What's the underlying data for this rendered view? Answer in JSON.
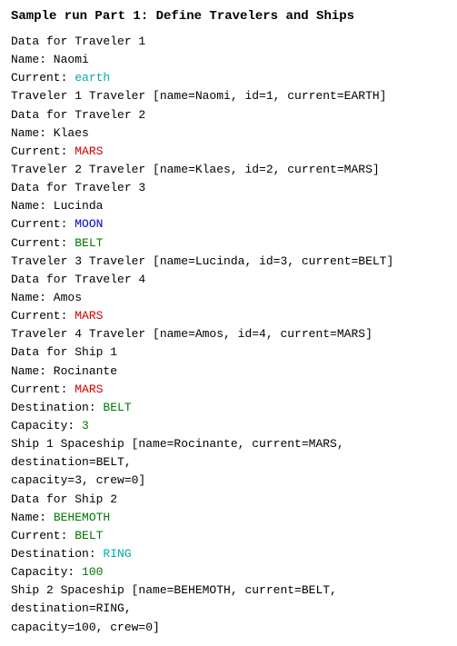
{
  "title": "Sample run Part 1: Define Travelers and Ships",
  "lines": [
    {
      "id": "l1",
      "parts": [
        {
          "text": "Data for Traveler 1",
          "color": "black"
        }
      ]
    },
    {
      "id": "l2",
      "parts": [
        {
          "text": "Name: Naomi",
          "color": "black"
        }
      ]
    },
    {
      "id": "l3",
      "parts": [
        {
          "text": "Current: ",
          "color": "black"
        },
        {
          "text": "earth",
          "color": "cyan"
        }
      ]
    },
    {
      "id": "l4",
      "parts": [
        {
          "text": "Traveler 1 Traveler [name=Naomi, id=1, current=EARTH]",
          "color": "black"
        }
      ]
    },
    {
      "id": "l5",
      "parts": [
        {
          "text": "Data for Traveler 2",
          "color": "black"
        }
      ]
    },
    {
      "id": "l6",
      "parts": [
        {
          "text": "Name: Klaes",
          "color": "black"
        }
      ]
    },
    {
      "id": "l7",
      "parts": [
        {
          "text": "Current: ",
          "color": "black"
        },
        {
          "text": "MARS",
          "color": "red"
        }
      ]
    },
    {
      "id": "l8",
      "parts": [
        {
          "text": "Traveler 2 Traveler [name=Klaes, id=2, current=MARS]",
          "color": "black"
        }
      ]
    },
    {
      "id": "l9",
      "parts": [
        {
          "text": "Data for Traveler 3",
          "color": "black"
        }
      ]
    },
    {
      "id": "l10",
      "parts": [
        {
          "text": "Name: Lucinda",
          "color": "black"
        }
      ]
    },
    {
      "id": "l11",
      "parts": [
        {
          "text": "Current: ",
          "color": "black"
        },
        {
          "text": "MOON",
          "color": "blue"
        }
      ]
    },
    {
      "id": "l12",
      "parts": [
        {
          "text": "Current: ",
          "color": "black"
        },
        {
          "text": "BELT",
          "color": "green"
        }
      ]
    },
    {
      "id": "l13",
      "parts": [
        {
          "text": "Traveler 3 Traveler [name=Lucinda, id=3, current=BELT]",
          "color": "black"
        }
      ]
    },
    {
      "id": "l14",
      "parts": [
        {
          "text": "Data for Traveler 4",
          "color": "black"
        }
      ]
    },
    {
      "id": "l15",
      "parts": [
        {
          "text": "Name: Amos",
          "color": "black"
        }
      ]
    },
    {
      "id": "l16",
      "parts": [
        {
          "text": "Current: ",
          "color": "black"
        },
        {
          "text": "MARS",
          "color": "red"
        }
      ]
    },
    {
      "id": "l17",
      "parts": [
        {
          "text": "Traveler 4 Traveler [name=Amos, id=4, current=MARS]",
          "color": "black"
        }
      ]
    },
    {
      "id": "l18",
      "parts": [
        {
          "text": "Data for Ship 1",
          "color": "black"
        }
      ]
    },
    {
      "id": "l19",
      "parts": [
        {
          "text": "Name: Rocinante",
          "color": "black"
        }
      ]
    },
    {
      "id": "l20",
      "parts": [
        {
          "text": "Current: ",
          "color": "black"
        },
        {
          "text": "MARS",
          "color": "red"
        }
      ]
    },
    {
      "id": "l21",
      "parts": [
        {
          "text": "Destination: ",
          "color": "black"
        },
        {
          "text": "BELT",
          "color": "green"
        }
      ]
    },
    {
      "id": "l22",
      "parts": [
        {
          "text": "Capacity: ",
          "color": "black"
        },
        {
          "text": "3",
          "color": "green"
        }
      ]
    },
    {
      "id": "l23",
      "parts": [
        {
          "text": "Ship 1 Spaceship [name=Rocinante, current=MARS, destination=BELT,",
          "color": "black"
        }
      ]
    },
    {
      "id": "l24",
      "parts": [
        {
          "text": "capacity=3, crew=0]",
          "color": "black"
        }
      ]
    },
    {
      "id": "l25",
      "parts": [
        {
          "text": "Data for Ship 2",
          "color": "black"
        }
      ]
    },
    {
      "id": "l26",
      "parts": [
        {
          "text": "Name: ",
          "color": "black"
        },
        {
          "text": "BEHEMOTH",
          "color": "green"
        }
      ]
    },
    {
      "id": "l27",
      "parts": [
        {
          "text": "Current: ",
          "color": "black"
        },
        {
          "text": "BELT",
          "color": "green"
        }
      ]
    },
    {
      "id": "l28",
      "parts": [
        {
          "text": "Destination: ",
          "color": "black"
        },
        {
          "text": "RING",
          "color": "cyan"
        }
      ]
    },
    {
      "id": "l29",
      "parts": [
        {
          "text": "Capacity: ",
          "color": "black"
        },
        {
          "text": "100",
          "color": "green"
        }
      ]
    },
    {
      "id": "l30",
      "parts": [
        {
          "text": "Ship 2 Spaceship [name=BEHEMOTH, current=BELT, destination=RING,",
          "color": "black"
        }
      ]
    },
    {
      "id": "l31",
      "parts": [
        {
          "text": "capacity=100, crew=0]",
          "color": "black"
        }
      ]
    }
  ],
  "colors": {
    "cyan": "#00aaaa",
    "red": "#cc0000",
    "blue": "#0000cc",
    "green": "#007700",
    "black": "#000000"
  }
}
